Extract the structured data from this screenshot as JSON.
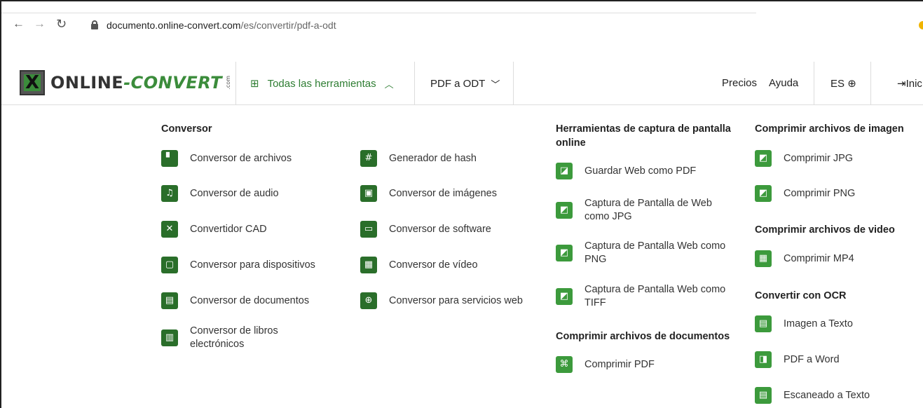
{
  "browser": {
    "url_domain": "documento.online-convert.com",
    "url_path": "/es/convertir/pdf-a-odt",
    "icons": [
      "back-icon",
      "forward-icon",
      "reload-icon",
      "lock-icon"
    ]
  },
  "header": {
    "logo_part1": "ONLINE",
    "logo_dash": "-",
    "logo_part2": "CONVERT",
    "logo_com": ".com",
    "tools_label": "Todas las herramientas",
    "pdf_label": "PDF a ODT",
    "precios": "Precios",
    "ayuda": "Ayuda",
    "lang": "ES",
    "login": "Inic"
  },
  "colors": {
    "accent": "#2e7d32",
    "icon_dark": "#2a6e2a",
    "icon_light": "#3c9a3c"
  },
  "menu": {
    "conversor_title": "Conversor",
    "conversor_col1": [
      {
        "label": "Conversor de archivos",
        "icon": "file-icon"
      },
      {
        "label": "Conversor de audio",
        "icon": "music-note-icon"
      },
      {
        "label": "Convertidor CAD",
        "icon": "cad-tools-icon"
      },
      {
        "label": "Conversor para dispositivos",
        "icon": "tablet-icon"
      },
      {
        "label": "Conversor de documentos",
        "icon": "document-icon"
      },
      {
        "label": "Conversor de libros electrónicos",
        "icon": "books-icon"
      }
    ],
    "conversor_col2": [
      {
        "label": "Generador de hash",
        "icon": "hash-icon"
      },
      {
        "label": "Conversor de imágenes",
        "icon": "image-icon"
      },
      {
        "label": "Conversor de software",
        "icon": "monitor-icon"
      },
      {
        "label": "Conversor de vídeo",
        "icon": "film-icon"
      },
      {
        "label": "Conversor para servicios web",
        "icon": "globe-icon"
      }
    ],
    "screenshot_title": "Herramientas de captura de pantalla online",
    "screenshot_items": [
      {
        "label": "Guardar Web como PDF",
        "icon": "pdf-file-icon"
      },
      {
        "label": "Captura de Pantalla de Web como JPG",
        "icon": "image-file-icon"
      },
      {
        "label": "Captura de Pantalla Web como PNG",
        "icon": "image-file-icon"
      },
      {
        "label": "Captura de Pantalla Web como TIFF",
        "icon": "image-file-icon"
      }
    ],
    "compress_docs_title": "Comprimir archivos de documentos",
    "compress_docs_items": [
      {
        "label": "Comprimir PDF",
        "icon": "compress-icon"
      }
    ],
    "compress_img_title": "Comprimir archivos de imagen",
    "compress_img_items": [
      {
        "label": "Comprimir JPG",
        "icon": "image-file-icon"
      },
      {
        "label": "Comprimir PNG",
        "icon": "image-file-icon"
      }
    ],
    "compress_video_title": "Comprimir archivos de video",
    "compress_video_items": [
      {
        "label": "Comprimir MP4",
        "icon": "film-icon"
      }
    ],
    "ocr_title": "Convertir con OCR",
    "ocr_items": [
      {
        "label": "Imagen a Texto",
        "icon": "document-icon"
      },
      {
        "label": "PDF a Word",
        "icon": "word-file-icon"
      },
      {
        "label": "Escaneado a Texto",
        "icon": "document-icon"
      }
    ]
  }
}
